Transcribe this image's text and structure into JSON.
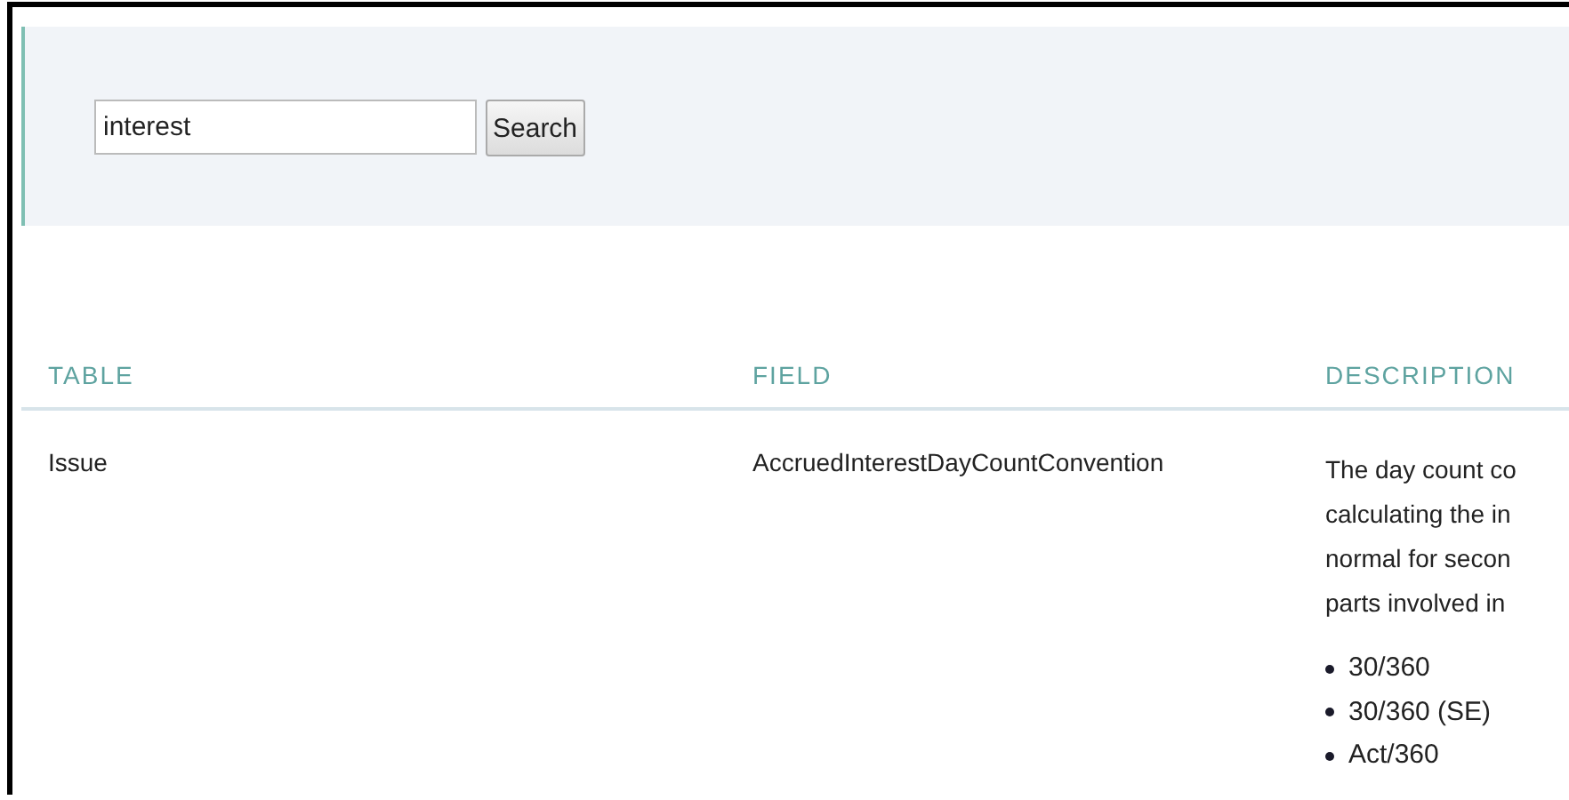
{
  "search": {
    "value": "interest",
    "button": "Search"
  },
  "table": {
    "columns": [
      "TABLE",
      "FIELD",
      "DESCRIPTION"
    ],
    "rows": [
      {
        "table": "Issue",
        "field": "AccruedInterestDayCountConvention",
        "description_lines": [
          "The day count co",
          "calculating the in",
          "normal for secon",
          "parts involved in"
        ],
        "options": [
          "30/360",
          "30/360 (SE)",
          "Act/360"
        ]
      }
    ]
  }
}
